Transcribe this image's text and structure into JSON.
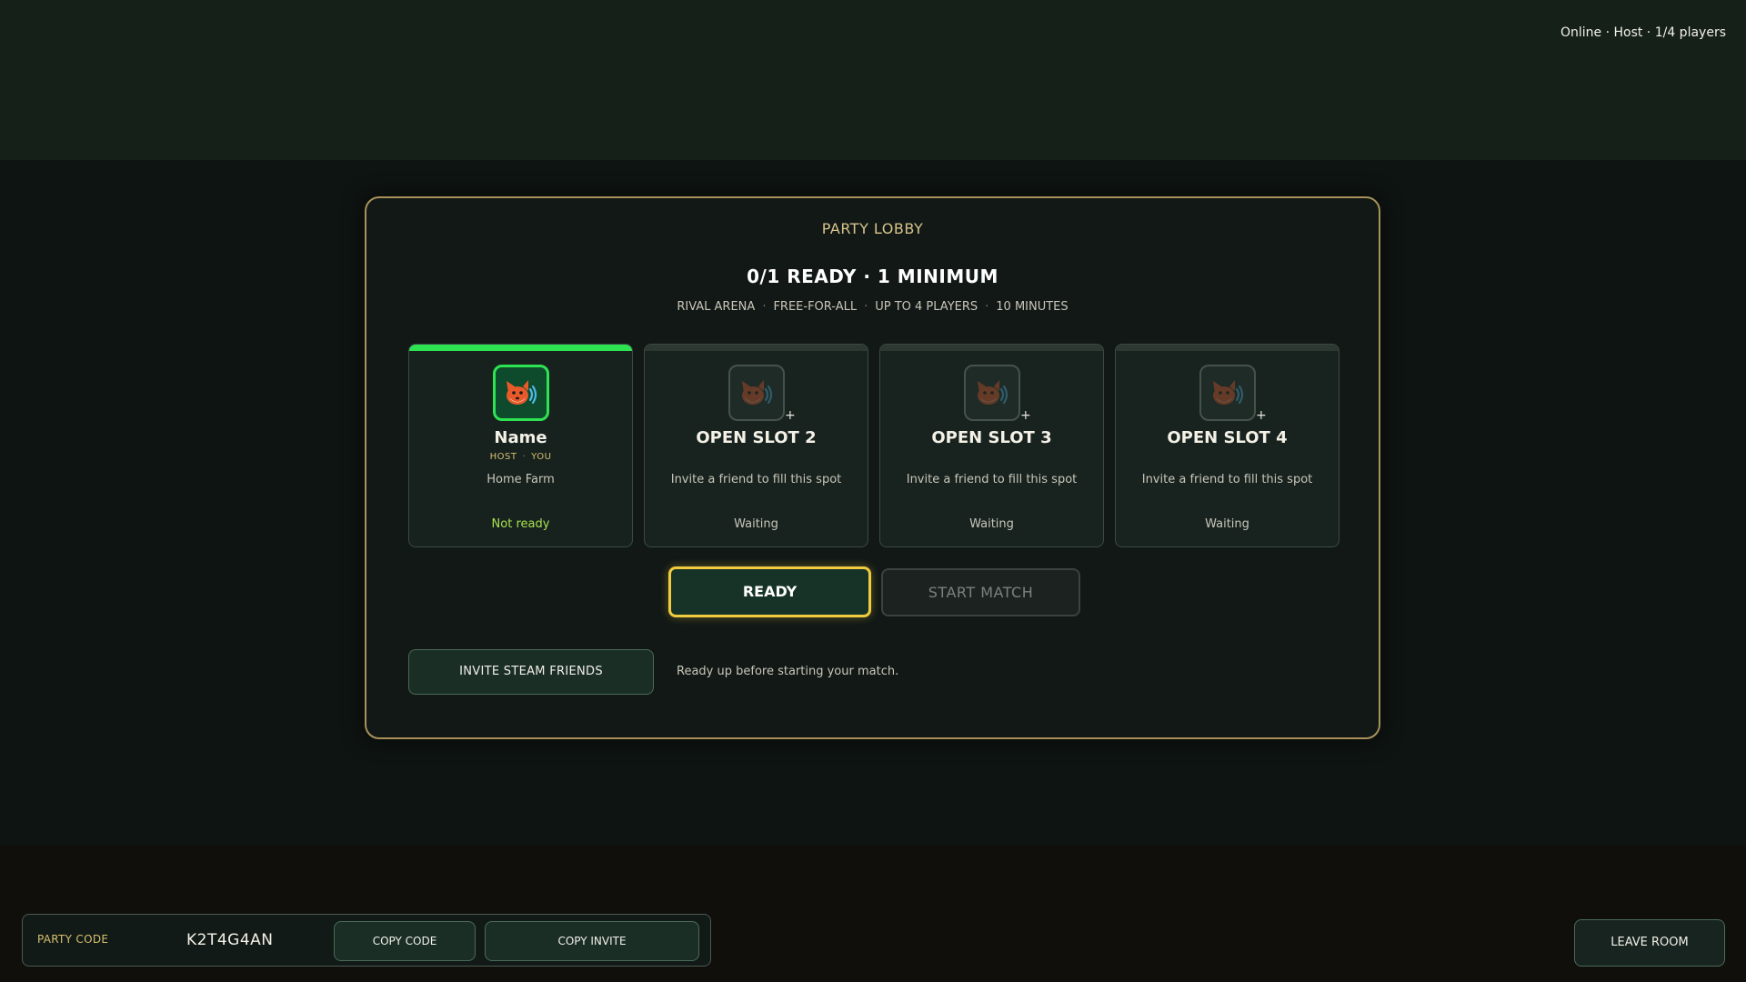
{
  "status": {
    "text": "Online · Host · 1/4 players"
  },
  "lobby": {
    "label": "PARTY LOBBY",
    "ready_count": "0/1 READY · 1 MINIMUM",
    "mode": [
      "RIVAL ARENA",
      "FREE-FOR-ALL",
      "UP TO 4 PLAYERS",
      "10 MINUTES"
    ]
  },
  "slots": [
    {
      "name": "Name",
      "role": [
        "HOST",
        "YOU"
      ],
      "sub": "Home Farm",
      "status": "Not ready",
      "filled": true,
      "icon": "fox-avatar-icon"
    },
    {
      "name": "OPEN SLOT 2",
      "sub": "Invite a friend to fill this spot",
      "status": "Waiting",
      "filled": false,
      "icon": "fox-avatar-icon",
      "plus": "+"
    },
    {
      "name": "OPEN SLOT 3",
      "sub": "Invite a friend to fill this spot",
      "status": "Waiting",
      "filled": false,
      "icon": "fox-avatar-icon",
      "plus": "+"
    },
    {
      "name": "OPEN SLOT 4",
      "sub": "Invite a friend to fill this spot",
      "status": "Waiting",
      "filled": false,
      "icon": "fox-avatar-icon",
      "plus": "+"
    }
  ],
  "actions": {
    "ready_label": "READY",
    "start_label": "START MATCH",
    "invite_label": "INVITE STEAM FRIENDS",
    "hint": "Ready up before starting your match."
  },
  "party": {
    "code_label": "PARTY CODE",
    "code": "K2T4G4AN",
    "copy_code_label": "COPY CODE",
    "copy_invite_label": "COPY INVITE"
  },
  "leave_label": "LEAVE ROOM",
  "colors": {
    "accent_gold": "#f1cb3f",
    "ready_green": "#2ee352",
    "status_ready_text": "#a7e04f",
    "panel_border": "#a8925a"
  }
}
